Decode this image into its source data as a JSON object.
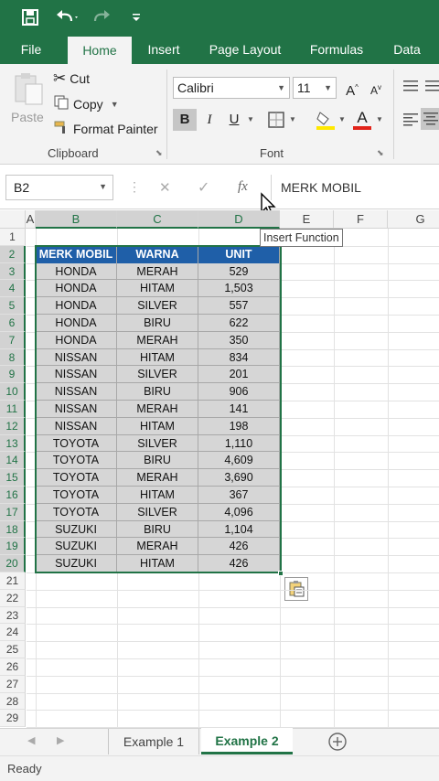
{
  "qat": {
    "save_icon": "save-icon",
    "undo_icon": "undo-icon",
    "redo_icon": "redo-icon",
    "customize_icon": "customize-icon"
  },
  "tabs": [
    "File",
    "Home",
    "Insert",
    "Page Layout",
    "Formulas",
    "Data"
  ],
  "active_tab": "Home",
  "clipboard": {
    "paste": "Paste",
    "cut": "Cut",
    "copy": "Copy",
    "format_painter": "Format Painter",
    "group": "Clipboard"
  },
  "font": {
    "name": "Calibri",
    "size": "11",
    "group": "Font",
    "bold": "B",
    "italic": "I",
    "underline": "U",
    "grow": "A",
    "shrink": "A",
    "color_letter": "A"
  },
  "formula_bar": {
    "name_box": "B2",
    "cancel": "✕",
    "enter": "✓",
    "fx": "fx",
    "value": "MERK MOBIL"
  },
  "tooltip": "Insert Function",
  "columns": [
    "A",
    "B",
    "C",
    "D",
    "E",
    "F",
    "G"
  ],
  "rows": [
    "1",
    "2",
    "3",
    "4",
    "5",
    "6",
    "7",
    "8",
    "9",
    "10",
    "11",
    "12",
    "13",
    "14",
    "15",
    "16",
    "17",
    "18",
    "19",
    "20",
    "21",
    "22",
    "23",
    "24",
    "25",
    "26",
    "27",
    "28",
    "29"
  ],
  "table": {
    "headers": [
      "MERK MOBIL",
      "WARNA",
      "UNIT"
    ],
    "rows": [
      [
        "HONDA",
        "MERAH",
        "529"
      ],
      [
        "HONDA",
        "HITAM",
        "1,503"
      ],
      [
        "HONDA",
        "SILVER",
        "557"
      ],
      [
        "HONDA",
        "BIRU",
        "622"
      ],
      [
        "HONDA",
        "MERAH",
        "350"
      ],
      [
        "NISSAN",
        "HITAM",
        "834"
      ],
      [
        "NISSAN",
        "SILVER",
        "201"
      ],
      [
        "NISSAN",
        "BIRU",
        "906"
      ],
      [
        "NISSAN",
        "MERAH",
        "141"
      ],
      [
        "NISSAN",
        "HITAM",
        "198"
      ],
      [
        "TOYOTA",
        "SILVER",
        "1,110"
      ],
      [
        "TOYOTA",
        "BIRU",
        "4,609"
      ],
      [
        "TOYOTA",
        "MERAH",
        "3,690"
      ],
      [
        "TOYOTA",
        "HITAM",
        "367"
      ],
      [
        "TOYOTA",
        "SILVER",
        "4,096"
      ],
      [
        "SUZUKI",
        "BIRU",
        "1,104"
      ],
      [
        "SUZUKI",
        "MERAH",
        "426"
      ],
      [
        "SUZUKI",
        "HITAM",
        "426"
      ]
    ]
  },
  "sheets": [
    "Example 1",
    "Example 2"
  ],
  "active_sheet": "Example 2",
  "status": "Ready",
  "colors": {
    "accent": "#217346",
    "header_fill": "#1f5fa8",
    "cell_fill": "#d6d6d6"
  }
}
